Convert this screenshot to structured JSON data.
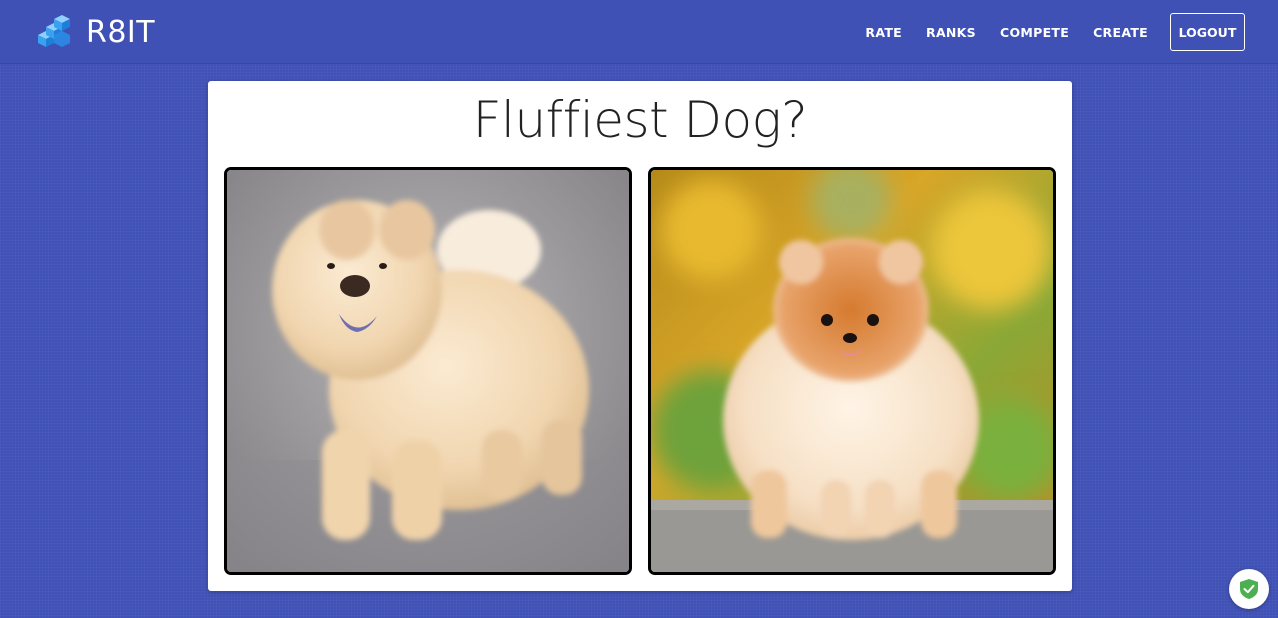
{
  "brand": {
    "name": "R8IT",
    "logo_icon": "stacked-blocks-logo-icon"
  },
  "nav": {
    "links": [
      "RATE",
      "RANKS",
      "COMPETE",
      "CREATE"
    ],
    "logout_label": "LOGOUT"
  },
  "poll": {
    "question": "Fluffiest Dog?",
    "choices": [
      {
        "subject": "cream chow chow dog photo"
      },
      {
        "subject": "orange pomeranian dog photo"
      }
    ]
  },
  "widget": {
    "icon": "shield-check-icon"
  },
  "colors": {
    "navbar": "#3f51b5",
    "background": "#4152b6",
    "card": "#ffffff",
    "shield": "#4caf50"
  }
}
